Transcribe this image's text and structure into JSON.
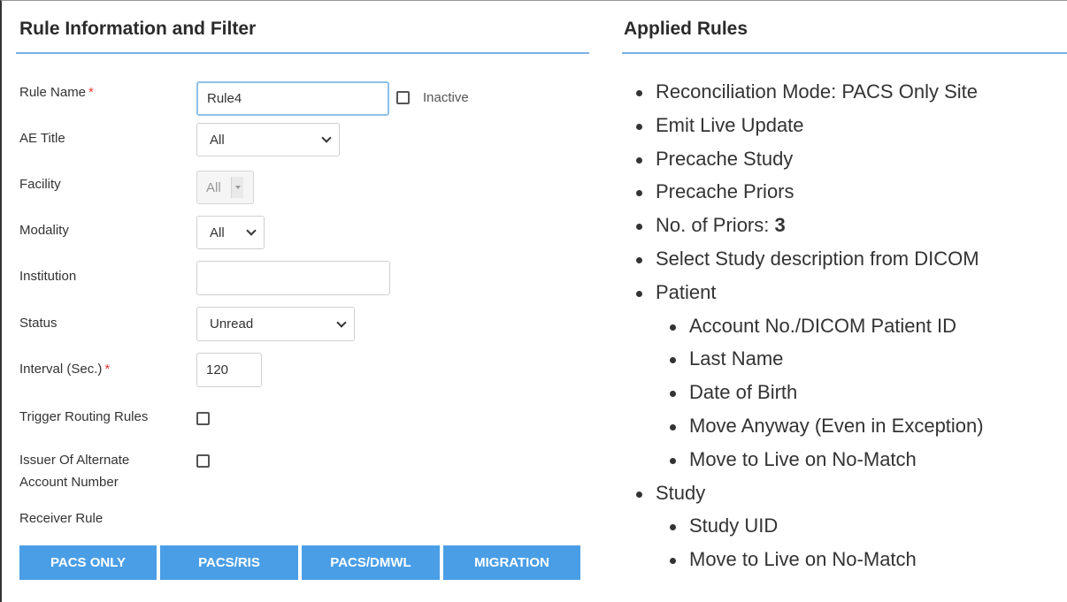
{
  "left_panel": {
    "title": "Rule Information and Filter",
    "required_mark": "*",
    "fields": {
      "rule_name": {
        "label": "Rule Name",
        "value": "Rule4",
        "inactive_label": "Inactive",
        "inactive_checked": false
      },
      "ae_title": {
        "label": "AE Title",
        "selected": "All"
      },
      "facility": {
        "label": "Facility",
        "selected": "All",
        "disabled": true
      },
      "modality": {
        "label": "Modality",
        "selected": "All"
      },
      "institution": {
        "label": "Institution",
        "value": ""
      },
      "status": {
        "label": "Status",
        "selected": "Unread"
      },
      "interval": {
        "label": "Interval (Sec.)",
        "value": "120"
      },
      "trigger_routing": {
        "label": "Trigger Routing Rules",
        "checked": false
      },
      "issuer": {
        "label_line1": "Issuer Of Alternate",
        "label_line2": "Account Number",
        "checked": false
      },
      "receiver_rule": {
        "label": "Receiver Rule"
      }
    },
    "buttons": [
      "PACS ONLY",
      "PACS/RIS",
      "PACS/DMWL",
      "MIGRATION"
    ]
  },
  "right_panel": {
    "title": "Applied Rules",
    "items": [
      {
        "text": "Reconciliation Mode: PACS Only Site"
      },
      {
        "text": "Emit Live Update"
      },
      {
        "text": "Precache Study"
      },
      {
        "text": "Precache Priors"
      },
      {
        "text": "No. of Priors: ",
        "bold": "3"
      },
      {
        "text": "Select Study description from DICOM"
      },
      {
        "text": "Patient"
      },
      {
        "text": "Account No./DICOM Patient ID",
        "sub": true
      },
      {
        "text": "Last Name",
        "sub": true
      },
      {
        "text": "Date of Birth",
        "sub": true
      },
      {
        "text": "Move Anyway (Even in Exception)",
        "sub": true
      },
      {
        "text": "Move to Live on No-Match",
        "sub": true
      },
      {
        "text": "Study"
      },
      {
        "text": "Study UID",
        "sub": true
      },
      {
        "text": "Move to Live on No-Match",
        "sub": true
      }
    ]
  },
  "colors": {
    "accent_line": "#7ab1e0",
    "button_bg": "#4a9ee6",
    "required": "#e53935"
  }
}
